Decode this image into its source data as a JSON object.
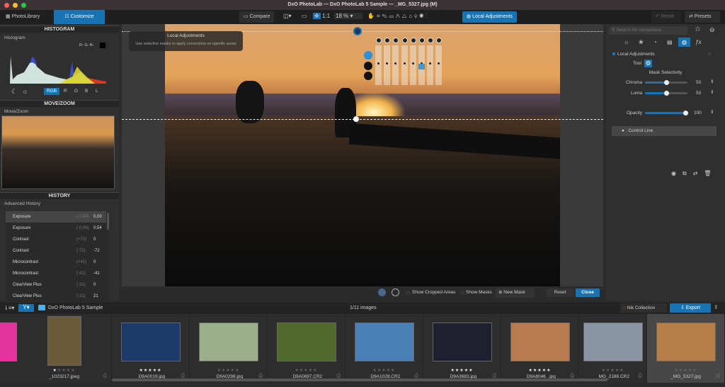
{
  "window": {
    "title": "DxO PhotoLab — DxO PhotoLab 5 Sample — _MG_5327.jpg (M)"
  },
  "toolbar": {
    "photolibrary": "PhotoLibrary",
    "customize": "Customize",
    "compare": "Compare",
    "zoom_1to1": "1:1",
    "zoom_value": "18 %",
    "local_adjustments": "Local Adjustments",
    "reset": "Reset",
    "presets": "Presets"
  },
  "histogram": {
    "header": "HISTOGRAM",
    "section": "Histogram",
    "rgb_readout": "R- G- B-",
    "channels": [
      "RGB",
      "R",
      "G",
      "B",
      "L"
    ],
    "active_channel": "RGB"
  },
  "movezoom": {
    "header": "MOVE/ZOOM",
    "section": "Move/Zoom"
  },
  "history": {
    "header": "HISTORY",
    "section": "Advanced History",
    "items": [
      {
        "name": "Exposure",
        "delta": "(-0,54)",
        "value": "0,00",
        "selected": true
      },
      {
        "name": "Exposure",
        "delta": "(-0,06)",
        "value": "0,54"
      },
      {
        "name": "Contrast",
        "delta": "(+72)",
        "value": "0"
      },
      {
        "name": "Contrast",
        "delta": "(-72)",
        "value": "-72"
      },
      {
        "name": "Microcontrast",
        "delta": "(+41)",
        "value": "0"
      },
      {
        "name": "Microcontrast",
        "delta": "(-41)",
        "value": "-41"
      },
      {
        "name": "ClearView Plus",
        "delta": "(-21)",
        "value": "0"
      },
      {
        "name": "ClearView Plus",
        "delta": "(-21)",
        "value": "21"
      }
    ]
  },
  "tooltip": {
    "title": "Local Adjustments",
    "text": "Use selective masks to apply corrections on specific areas"
  },
  "viewer_bar": {
    "show_cropped": "Show Cropped Areas",
    "show_masks": "Show Masks",
    "new_mask": "New Mask",
    "reset": "Reset",
    "close": "Close"
  },
  "right": {
    "search_placeholder": "Search for corrections",
    "section": "Local Adjustments",
    "tool_label": "Tool",
    "mask_selectivity": "Mask Selectivity",
    "chroma": {
      "label": "Chroma",
      "value": "50",
      "fraction": 0.5
    },
    "luma": {
      "label": "Luma",
      "value": "50",
      "fraction": 0.5
    },
    "opacity": {
      "label": "Opacity",
      "value": "100",
      "fraction": 1.0
    },
    "mask_item": "Control Line"
  },
  "filmstrip": {
    "folder": "DxO PhotoLab 5 Sample",
    "count": "1/11 images",
    "nik": "Nik Collection",
    "export": "Export",
    "items": [
      {
        "name": "_1023217.jpeg",
        "stars": 1,
        "color": "#6b5a3c"
      },
      {
        "name": "_D9A0019.jpg",
        "stars": 5,
        "color": "#1d3a6a"
      },
      {
        "name": "_D9A0298.jpg",
        "stars": 0,
        "color": "#9bb08a"
      },
      {
        "name": "_D9A0697.CR2",
        "stars": 0,
        "color": "#4f6a2c"
      },
      {
        "name": "_D9A1028.CR2",
        "stars": 0,
        "color": "#4a7fb6"
      },
      {
        "name": "_D9A3683.jpg",
        "stars": 5,
        "color": "#1e2030"
      },
      {
        "name": "_D9A8046_.jpg",
        "stars": 5,
        "color": "#b87a4f"
      },
      {
        "name": "_MG_2188.CR2",
        "stars": 0,
        "color": "#8a96a6"
      },
      {
        "name": "_MG_5327.jpg",
        "stars": 0,
        "color": "#b47d4a",
        "selected": true
      }
    ]
  },
  "colors": {
    "accent": "#1873b3"
  }
}
